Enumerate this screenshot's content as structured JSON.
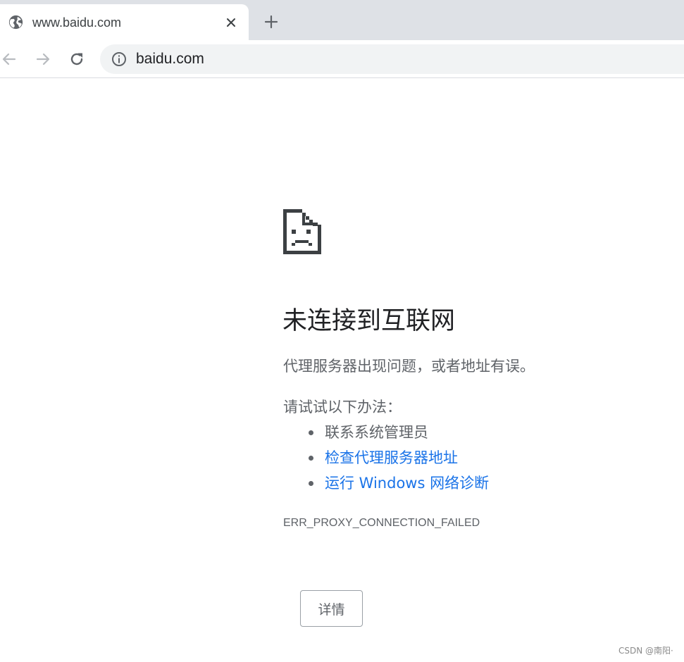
{
  "tab": {
    "title": "www.baidu.com",
    "favicon": "globe-icon",
    "close": "close-icon"
  },
  "toolbar": {
    "back": "arrow-left-icon",
    "forward": "arrow-right-icon",
    "reload": "reload-icon",
    "new_tab": "plus-icon"
  },
  "omnibox": {
    "url": "baidu.com",
    "security_icon": "info-icon"
  },
  "error_page": {
    "icon": "sad-document-icon",
    "title": "未连接到互联网",
    "description": "代理服务器出现问题，或者地址有误。",
    "suggestions_heading": "请试试以下办法：",
    "suggestions": [
      {
        "label": "联系系统管理员",
        "is_link": false
      },
      {
        "label": "检查代理服务器地址",
        "is_link": true
      },
      {
        "label": "运行 Windows 网络诊断",
        "is_link": true
      }
    ],
    "error_code": "ERR_PROXY_CONNECTION_FAILED",
    "details_button": "详情"
  },
  "watermark": "CSDN @南阳·",
  "colors": {
    "tabstrip_bg": "#dee1e6",
    "omnibox_bg": "#f1f3f4",
    "link": "#1a73e8",
    "secondary_text": "#5f6368",
    "primary_text": "#202124"
  }
}
